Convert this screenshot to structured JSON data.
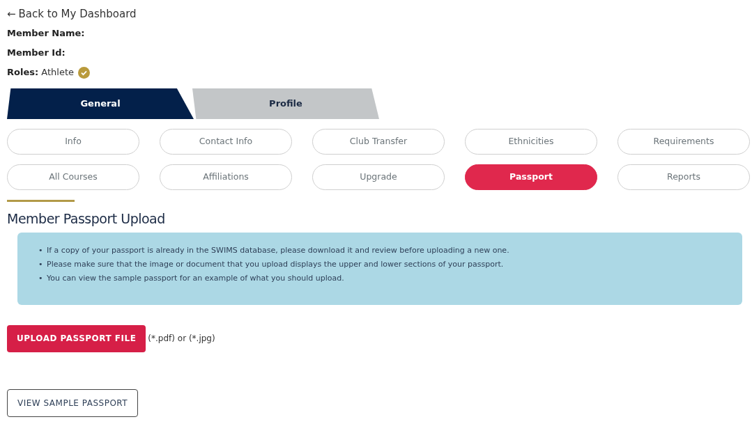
{
  "back_link": {
    "arrow": "←",
    "label": "Back to My Dashboard"
  },
  "member": [
    {
      "label": "Member Name:"
    },
    {
      "label": "Member Id:"
    },
    {
      "label": "Roles:",
      "value": "Athlete",
      "verified": true
    }
  ],
  "tabs": [
    {
      "label": "General",
      "selected": true
    },
    {
      "label": "Profile",
      "selected": false
    }
  ],
  "sub_tabs": [
    {
      "label": "Info",
      "selected": false
    },
    {
      "label": "Contact Info",
      "selected": false
    },
    {
      "label": "Club Transfer",
      "selected": false
    },
    {
      "label": "Ethnicities",
      "selected": false
    },
    {
      "label": "Requirements",
      "selected": false
    },
    {
      "label": "All Courses",
      "selected": false
    },
    {
      "label": "Affiliations",
      "selected": false
    },
    {
      "label": "Upgrade",
      "selected": false
    },
    {
      "label": "Passport",
      "selected": true
    },
    {
      "label": "Reports",
      "selected": false
    }
  ],
  "section_title": "Member Passport Upload",
  "note_bullet": "•",
  "notes": [
    "If a copy of your passport is already in the SWIMS database, please download it and review before uploading a new one.",
    "Please make sure that the image or document that you upload displays the upper and lower sections of your passport.",
    "You can view the sample passport for an example of what you should upload."
  ],
  "upload": {
    "button": "UPLOAD PASSPORT FILE",
    "hint": "(*.pdf) or (*.jpg)"
  },
  "sample_button": "VIEW SAMPLE PASSPORT"
}
